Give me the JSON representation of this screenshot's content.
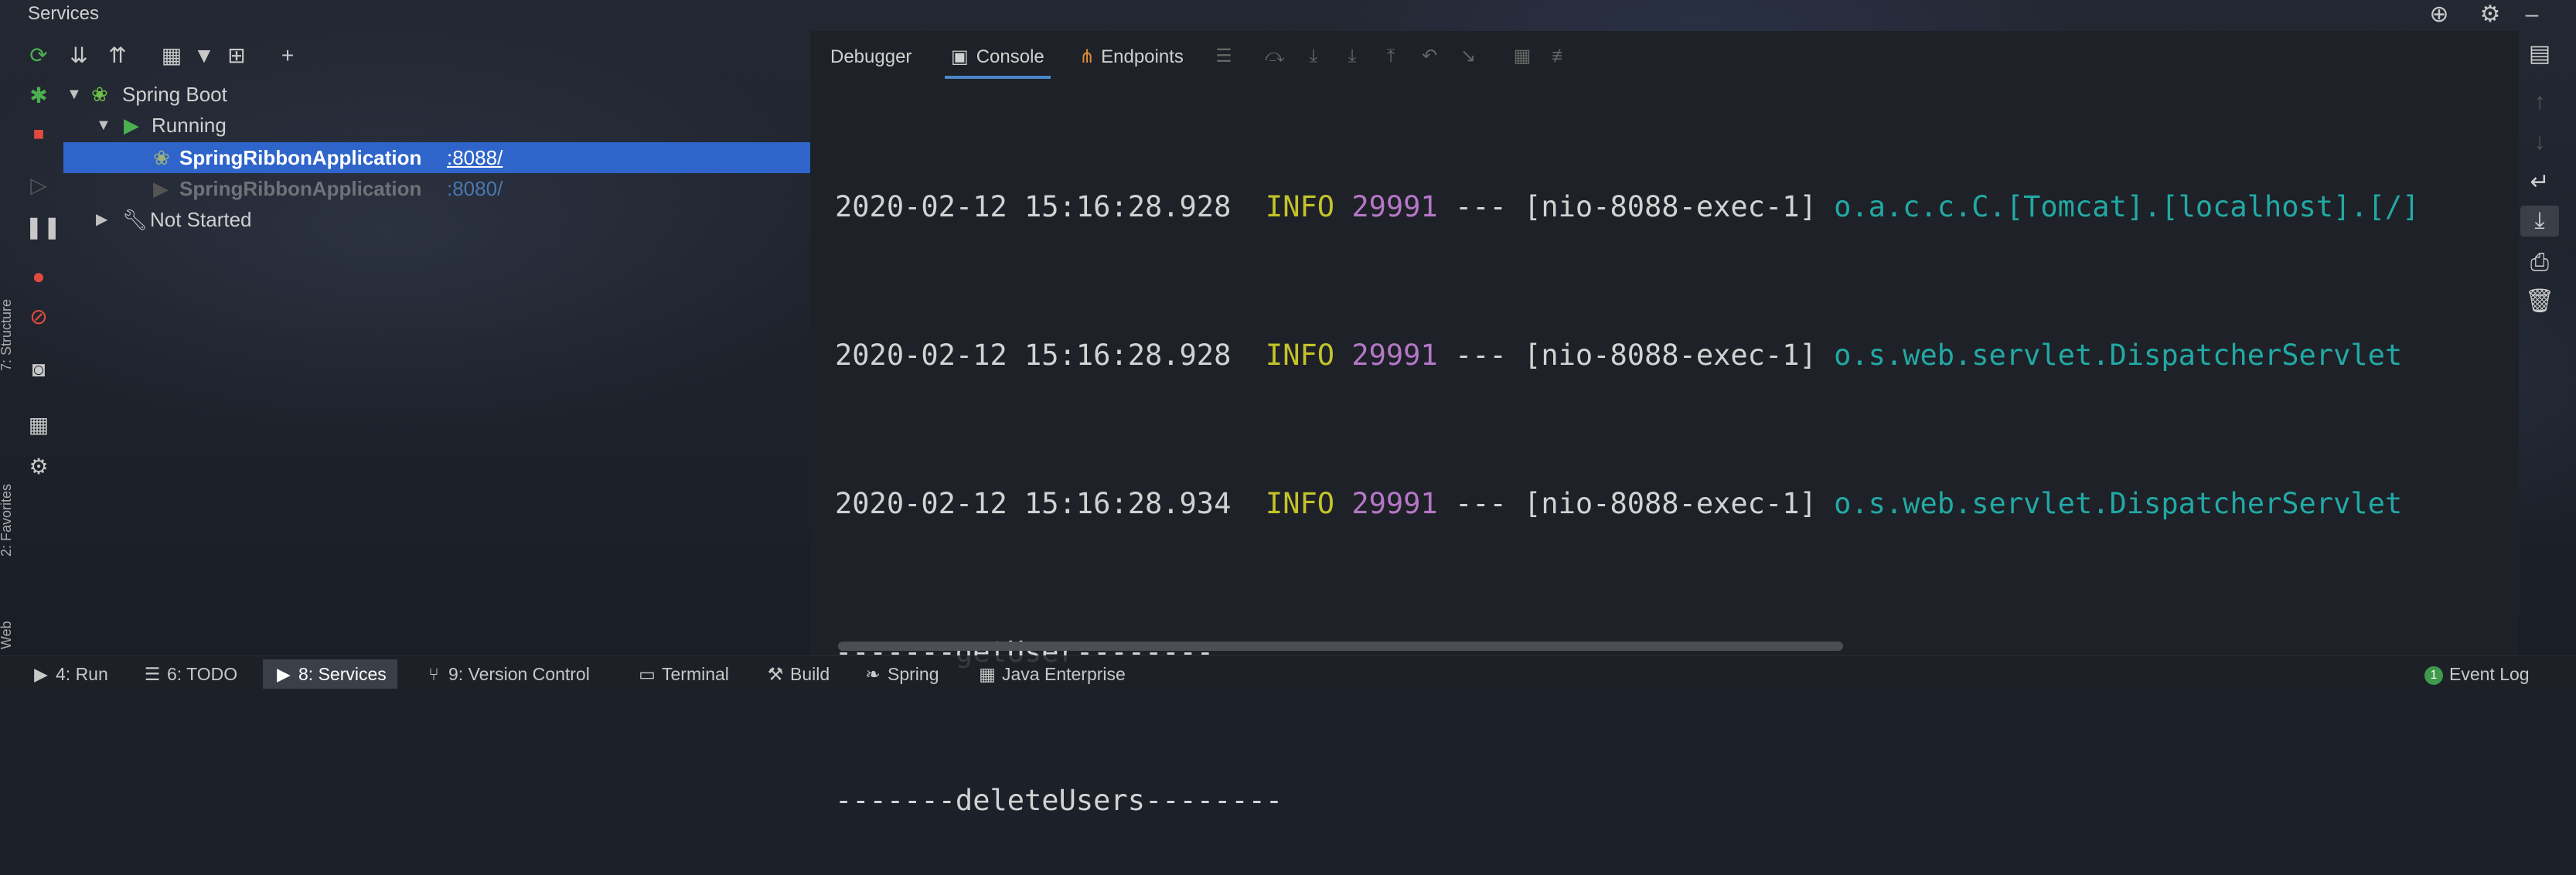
{
  "window": {
    "title": "Services"
  },
  "left_strip": [
    {
      "label": "7: Structure"
    },
    {
      "label": "2: Favorites"
    },
    {
      "label": "Web"
    }
  ],
  "tree": {
    "root": {
      "label": "Spring Boot"
    },
    "running": {
      "label": "Running"
    },
    "apps": [
      {
        "name": "SpringRibbonApplication",
        "port": ":8088/",
        "selected": true
      },
      {
        "name": "SpringRibbonApplication",
        "port": ":8080/",
        "selected": false
      }
    ],
    "not_started": {
      "label": "Not Started"
    }
  },
  "tabs": [
    {
      "label": "Debugger"
    },
    {
      "label": "Console",
      "active": true
    },
    {
      "label": "Endpoints"
    }
  ],
  "console": {
    "lines": [
      {
        "ts": "2020-02-12 15:16:28.928",
        "level": "INFO",
        "pid": "29991",
        "sep": "---",
        "thread": "[nio-8088-exec-1]",
        "logger": "o.a.c.c.C.[Tomcat].[localhost].[/]"
      },
      {
        "ts": "2020-02-12 15:16:28.928",
        "level": "INFO",
        "pid": "29991",
        "sep": "---",
        "thread": "[nio-8088-exec-1]",
        "logger": "o.s.web.servlet.DispatcherServlet"
      },
      {
        "ts": "2020-02-12 15:16:28.934",
        "level": "INFO",
        "pid": "29991",
        "sep": "---",
        "thread": "[nio-8088-exec-1]",
        "logger": "o.s.web.servlet.DispatcherServlet"
      }
    ],
    "plain_lines": [
      "-------getUser--------",
      "-------deleteUsers--------"
    ]
  },
  "bottom_tabs": [
    {
      "label": "4: Run",
      "icon": "play-icon"
    },
    {
      "label": "6: TODO",
      "icon": "list-icon"
    },
    {
      "label": "8: Services",
      "icon": "services-icon",
      "active": true
    },
    {
      "label": "9: Version Control",
      "icon": "vcs-icon"
    },
    {
      "label": "Terminal",
      "icon": "terminal-icon"
    },
    {
      "label": "Build",
      "icon": "hammer-icon"
    },
    {
      "label": "Spring",
      "icon": "spring-icon"
    },
    {
      "label": "Java Enterprise",
      "icon": "java-enterprise-icon"
    }
  ],
  "event_log": {
    "label": "Event Log",
    "count": "1"
  },
  "colors": {
    "selection": "#2f65ca",
    "info": "#c3c32a",
    "pid": "#b577c7",
    "logger": "#22a9a5",
    "run_green": "#4caf50",
    "stop_red": "#e04a3f"
  }
}
